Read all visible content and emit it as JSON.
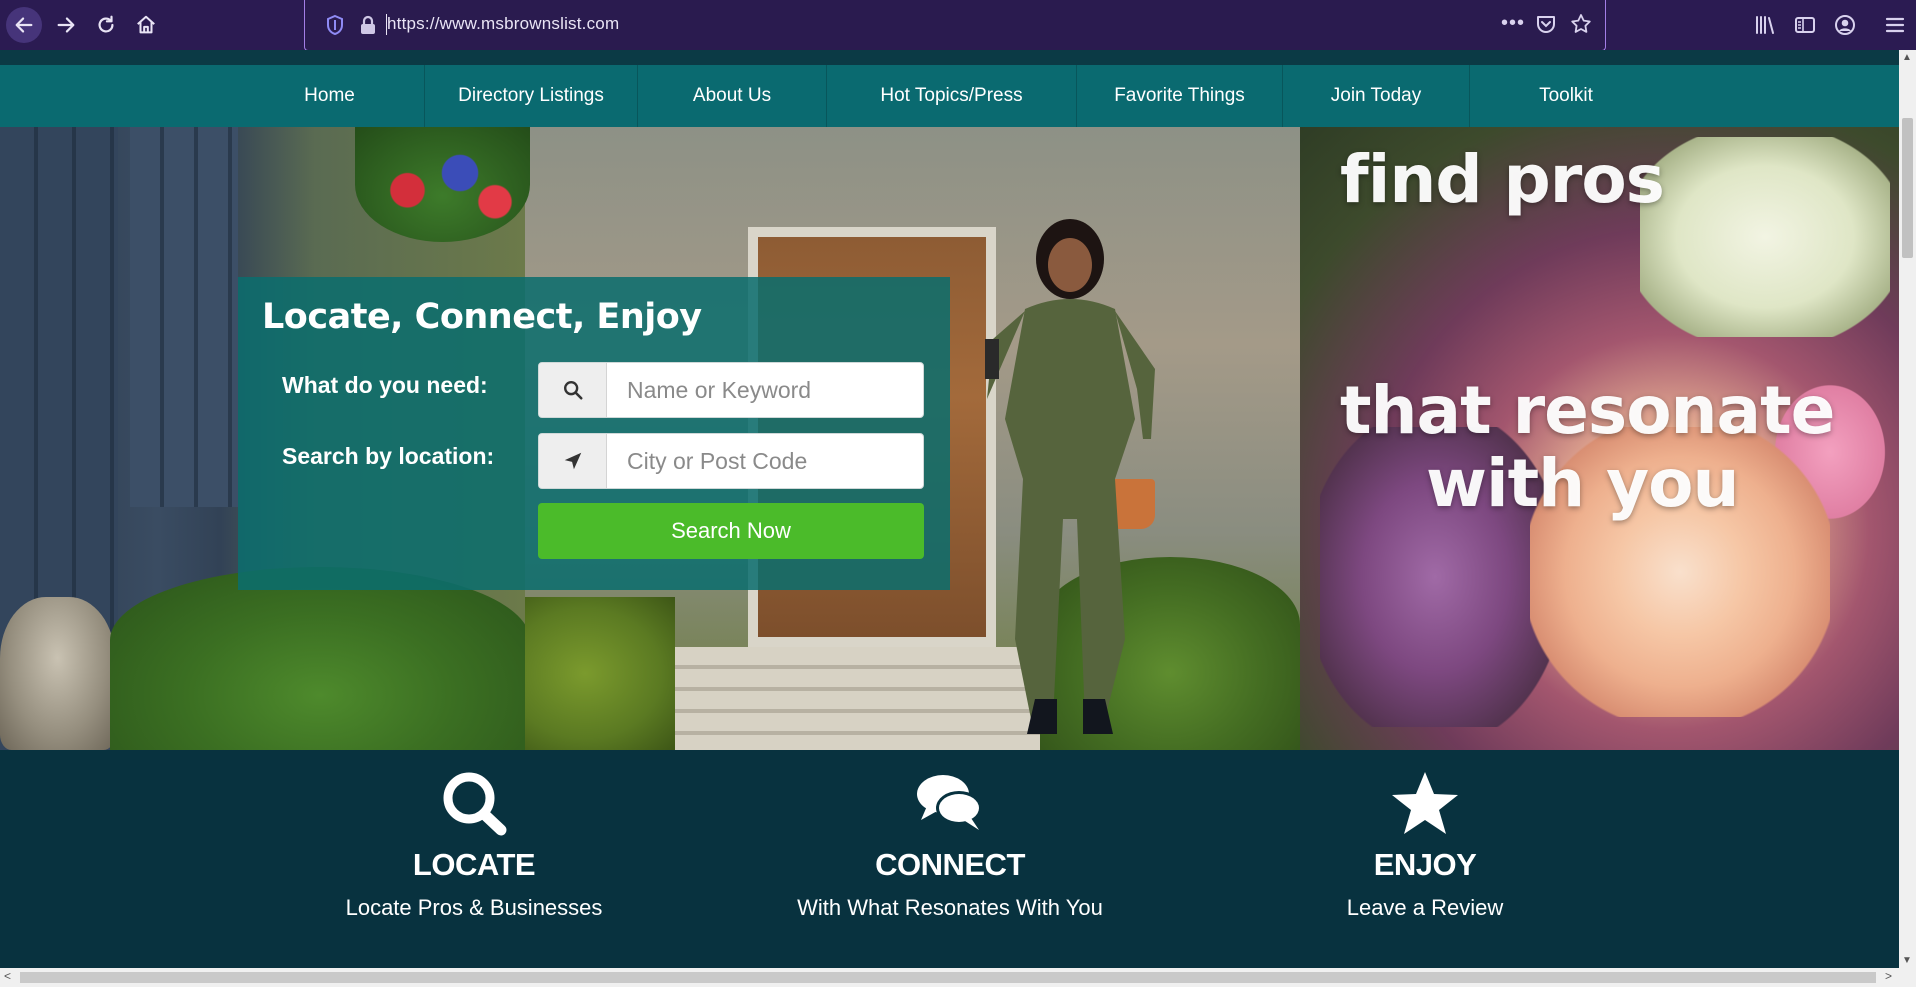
{
  "browser": {
    "url": "https://www.msbrownslist.com",
    "more_label": "•••",
    "accent": "#2b1b52"
  },
  "nav": {
    "items": [
      {
        "label": "Home"
      },
      {
        "label": "Directory Listings"
      },
      {
        "label": "About Us"
      },
      {
        "label": "Hot Topics/Press"
      },
      {
        "label": "Favorite Things"
      },
      {
        "label": "Join Today"
      },
      {
        "label": "Toolkit"
      }
    ],
    "color": "#0a6a70"
  },
  "hero": {
    "headline_1": "find pros",
    "headline_2": "that resonate",
    "headline_3": "with you"
  },
  "search": {
    "title": "Locate, Connect, Enjoy",
    "need_label": "What do you need:",
    "location_label": "Search by location:",
    "keyword_placeholder": "Name or Keyword",
    "location_placeholder": "City or Post Code",
    "button_label": "Search Now",
    "keyword_icon": "search-icon",
    "location_icon": "location-arrow-icon",
    "button_color": "#4bbb2a"
  },
  "features": [
    {
      "icon": "magnifier-icon",
      "title": "LOCATE",
      "subtitle": "Locate Pros & Businesses"
    },
    {
      "icon": "chat-bubbles-icon",
      "title": "CONNECT",
      "subtitle": "With What Resonates With You"
    },
    {
      "icon": "star-icon",
      "title": "ENJOY",
      "subtitle": "Leave a Review"
    }
  ],
  "scroll": {
    "up": "▲",
    "down": "▼",
    "left": "<",
    "right": ">"
  }
}
